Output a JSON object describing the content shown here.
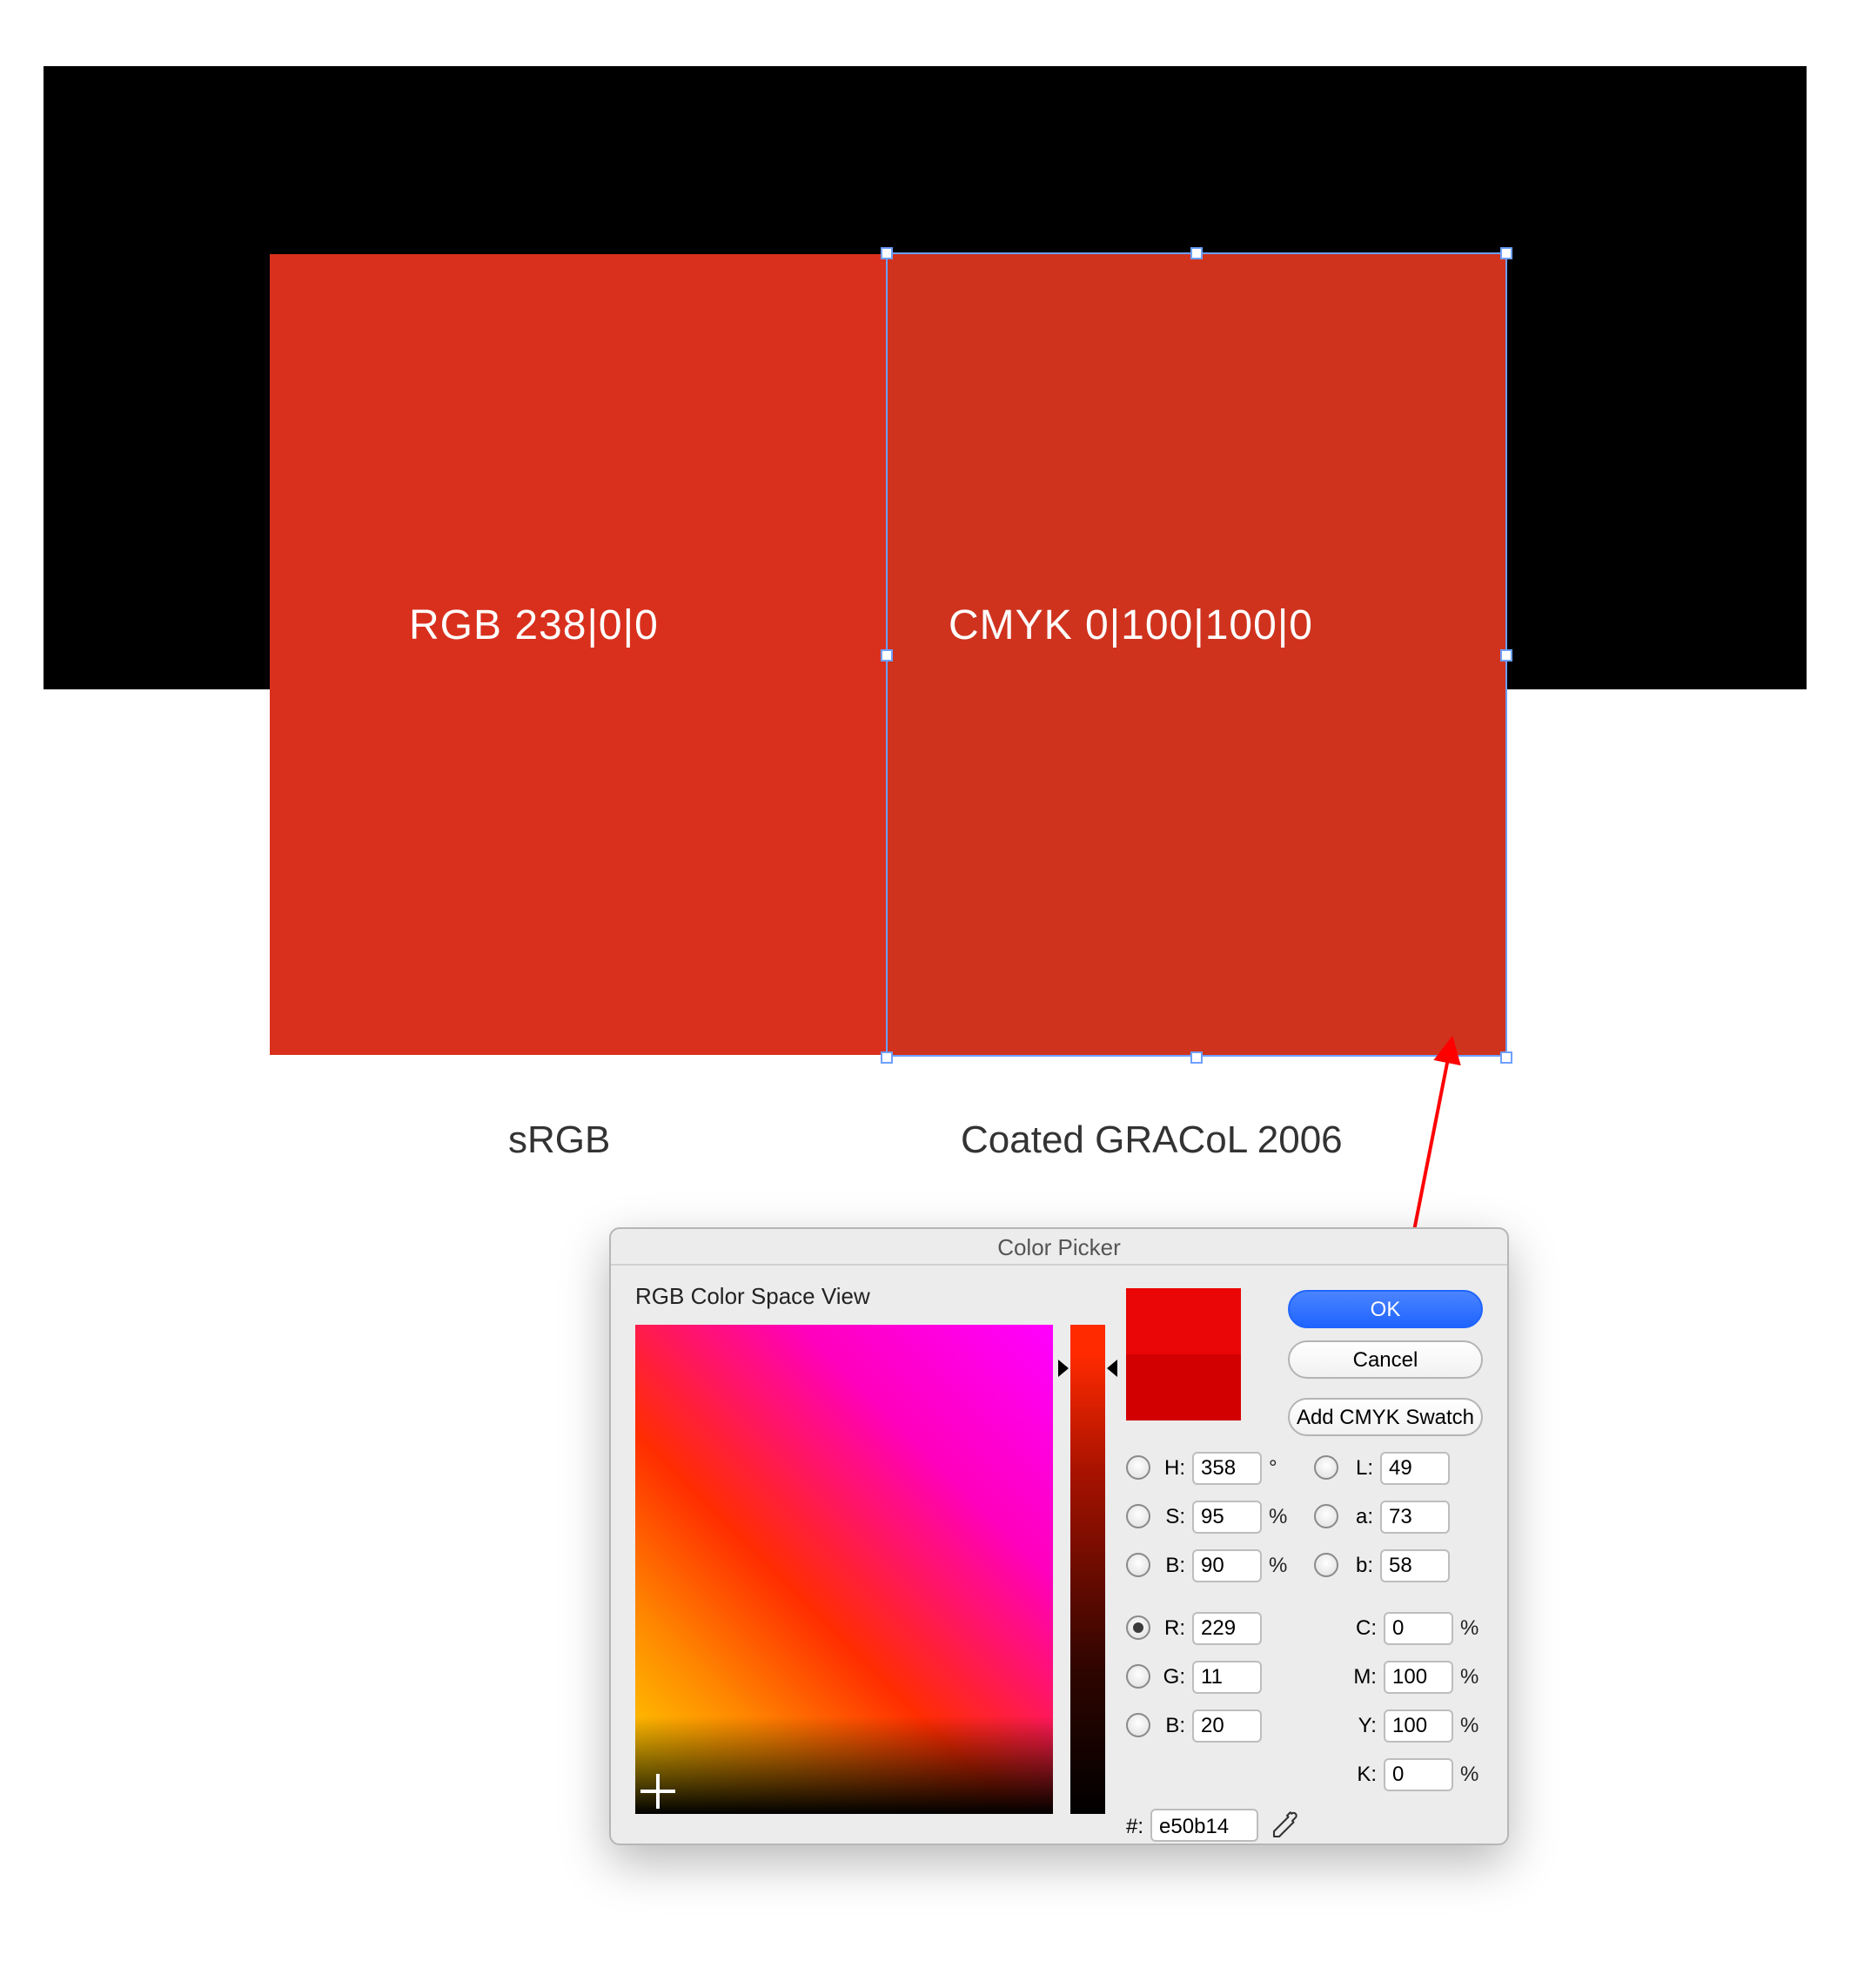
{
  "swatches": {
    "left": {
      "label": "RGB 238|0|0",
      "profile": "sRGB",
      "fill": "#d9301d"
    },
    "right": {
      "label": "CMYK 0|100|100|0",
      "profile": "Coated GRACoL 2006",
      "fill": "#cf331e"
    }
  },
  "picker": {
    "title": "Color Picker",
    "view": "RGB Color Space View",
    "buttons": {
      "ok": "OK",
      "cancel": "Cancel",
      "add_swatch": "Add CMYK Swatch"
    },
    "hsb": {
      "H": "358",
      "S": "95",
      "B": "90",
      "H_unit": "°",
      "pct": "%"
    },
    "rgb": {
      "R": "229",
      "G": "11",
      "B": "20"
    },
    "lab": {
      "L": "49",
      "a": "73",
      "b": "58"
    },
    "cmyk": {
      "C": "0",
      "M": "100",
      "Y": "100",
      "K": "0"
    },
    "hex": {
      "label": "#:",
      "value": "e50b14"
    },
    "selected_mode": "R"
  }
}
